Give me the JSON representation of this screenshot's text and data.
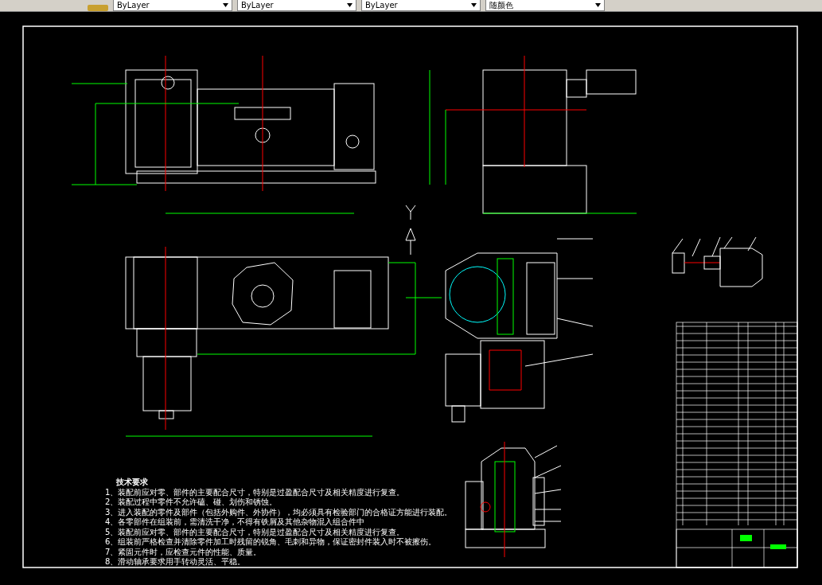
{
  "toolbar": {
    "dropdowns": [
      {
        "value": "ByLayer"
      },
      {
        "value": "ByLayer"
      },
      {
        "value": "ByLayer"
      },
      {
        "value": "随颜色"
      }
    ]
  },
  "drawing": {
    "technical_requirements": {
      "title": "技术要求",
      "items": [
        "1、装配前应对零、部件的主要配合尺寸，特别是过盈配合尺寸及相关精度进行复查。",
        "2、装配过程中零件不允许磕、碰、划伤和锈蚀。",
        "3、进入装配的零件及部件（包括外购件、外协件），均必须具有检验部门的合格证方能进行装配。",
        "4、各零部件在组装前，需清洗干净，不得有铁屑及其他杂物混入组合件中",
        "5、装配前应对零、部件的主要配合尺寸，特别是过盈配合尺寸及相关精度进行复查。",
        "6、组装前严格检查并清除零件加工时残留的锐角、毛刺和异物，保证密封件装入时不被擦伤。",
        "7、紧固元件时，应检查元件的性能、质量。",
        "8、滑动轴承要求用手转动灵活、平稳。"
      ]
    }
  }
}
